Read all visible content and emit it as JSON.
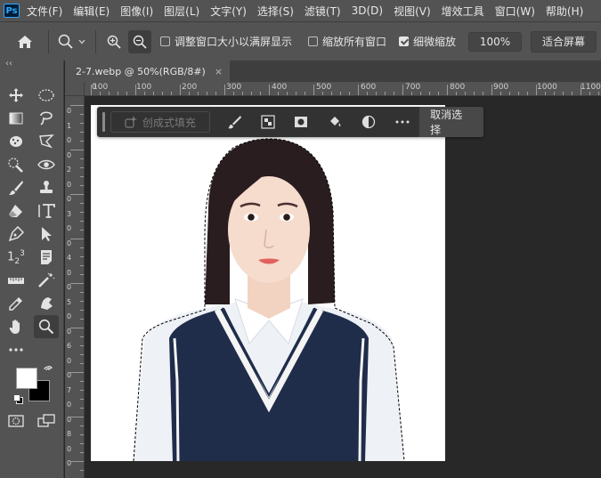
{
  "app": {
    "logo": "Ps"
  },
  "menubar": {
    "items": [
      "文件(F)",
      "编辑(E)",
      "图像(I)",
      "图层(L)",
      "文字(Y)",
      "选择(S)",
      "滤镜(T)",
      "3D(D)",
      "视图(V)",
      "增效工具",
      "窗口(W)",
      "帮助(H)"
    ]
  },
  "options": {
    "resize_windows_label": "调整窗口大小以满屏显示",
    "resize_windows_checked": false,
    "zoom_all_label": "缩放所有窗口",
    "zoom_all_checked": false,
    "scrubby_zoom_label": "细微缩放",
    "scrubby_zoom_checked": true,
    "zoom_value": "100%",
    "fit_screen_label": "适合屏幕"
  },
  "document_tab": {
    "title": "2-7.webp @ 50%(RGB/8#)",
    "close": "×"
  },
  "ruler_top": {
    "labels": [
      "100",
      "0",
      "100",
      "200",
      "300",
      "400",
      "500",
      "600",
      "700",
      "800",
      "900",
      "1000",
      "1100"
    ]
  },
  "ruler_left": {
    "labels": [
      "0",
      "1",
      "0",
      "0",
      "2",
      "0",
      "0",
      "3",
      "0",
      "0",
      "4",
      "0",
      "0",
      "5",
      "0",
      "0",
      "6",
      "0",
      "0",
      "7",
      "0",
      "0",
      "8",
      "0",
      "0"
    ]
  },
  "contextual_taskbar": {
    "generative_fill_label": "创成式填充",
    "deselect_label": "取消选择"
  },
  "toolbar": {
    "collapse": "‹‹"
  },
  "colors": {
    "foreground": "#ffffff",
    "background": "#000000",
    "ui_dark": "#535353",
    "canvas_bg": "#282828",
    "accent": "#31a8ff"
  }
}
